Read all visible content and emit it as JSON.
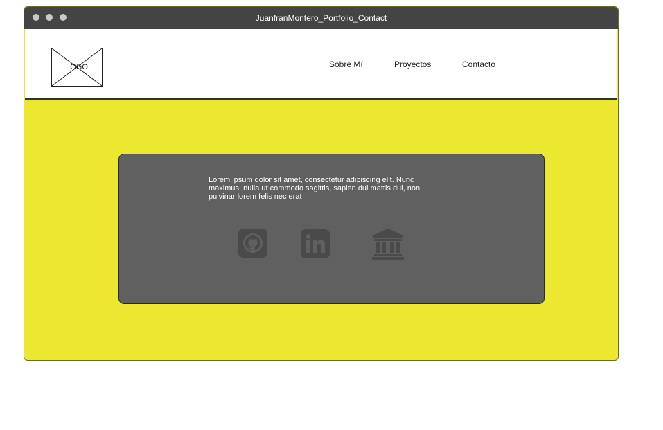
{
  "window": {
    "title": "JuanfranMontero_Portfolio_Contact"
  },
  "header": {
    "logo_label": "LOGO",
    "nav": [
      {
        "label": "Sobre Mí"
      },
      {
        "label": "Proyectos"
      },
      {
        "label": "Contacto"
      }
    ]
  },
  "contact_card": {
    "text": "Lorem ipsum dolor sit amet, consectetur adipiscing elit. Nunc maximus, nulla ut commodo sagittis, sapien dui mattis dui, non pulvinar lorem felis nec erat",
    "icons": [
      "github-icon",
      "linkedin-icon",
      "bank-icon"
    ]
  },
  "colors": {
    "background": "#ece82f",
    "card": "#606060",
    "icon": "#4a4a4a",
    "titlebar": "#444444"
  }
}
